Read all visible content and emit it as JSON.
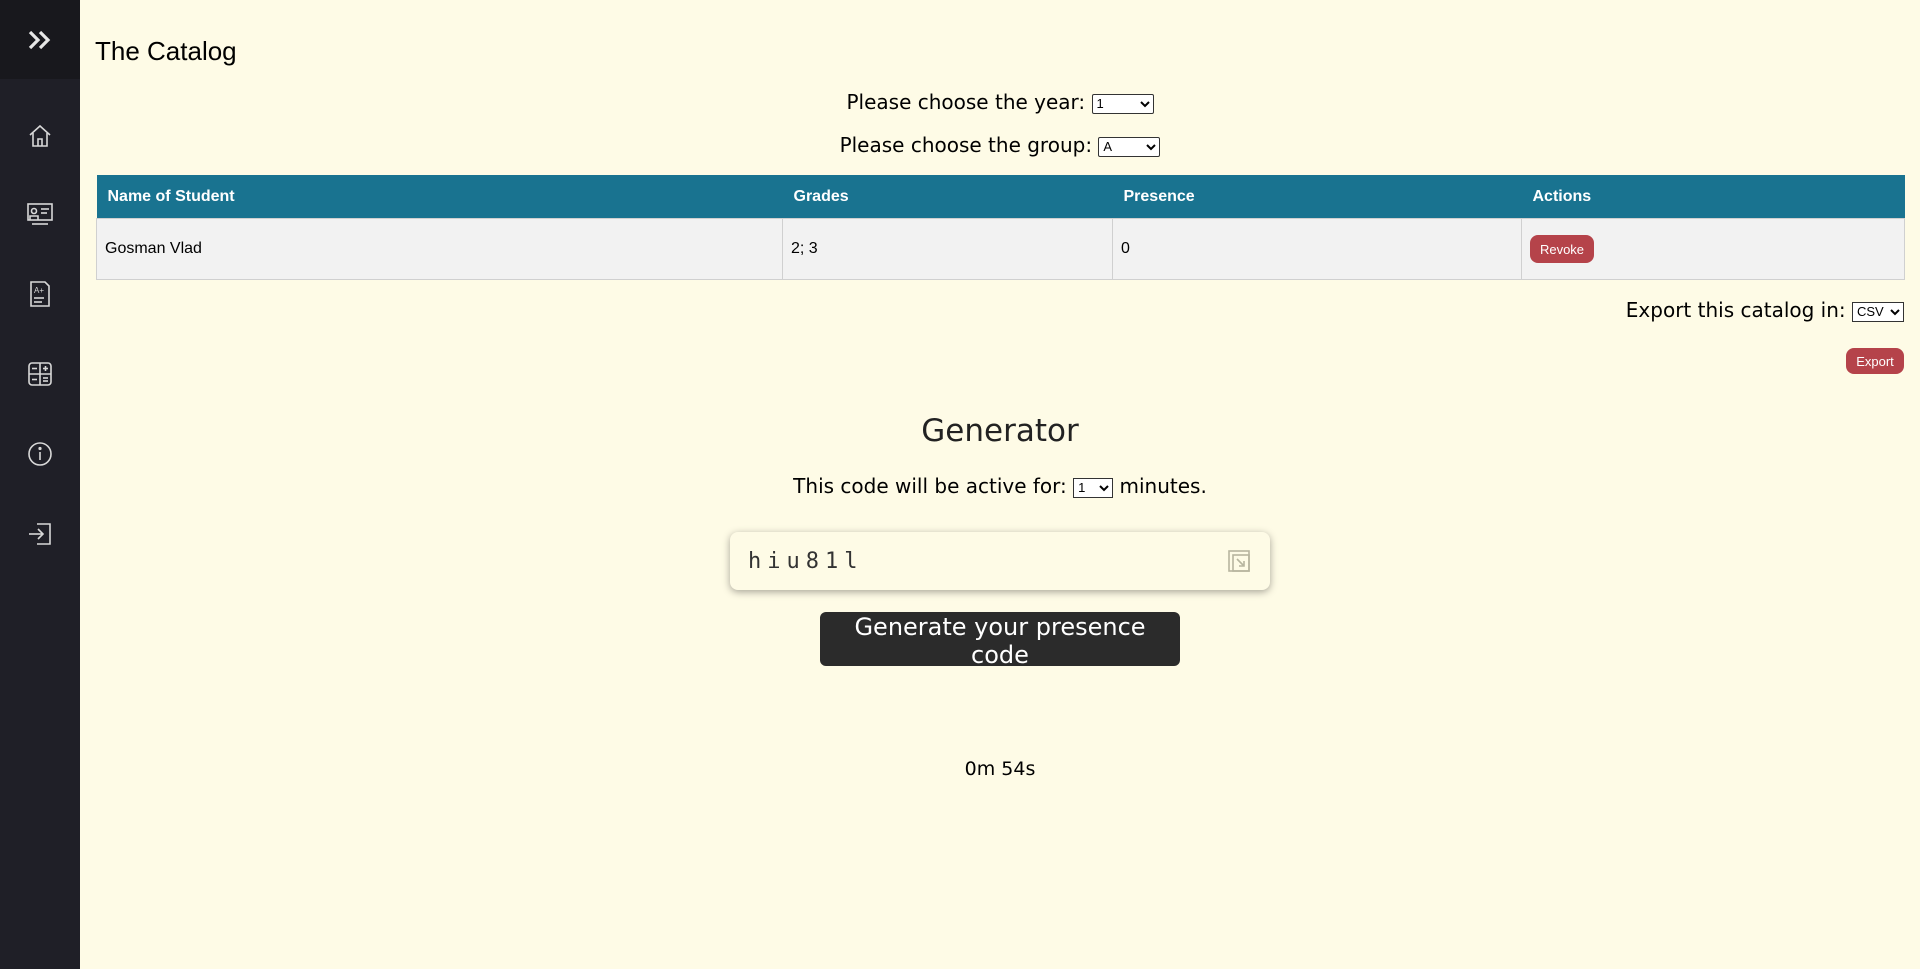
{
  "sidebar": {
    "toggle_label": "»",
    "items": [
      {
        "icon": "home-icon"
      },
      {
        "icon": "teacher-board-icon"
      },
      {
        "icon": "grades-document-icon"
      },
      {
        "icon": "calculator-icon"
      },
      {
        "icon": "info-icon"
      },
      {
        "icon": "logout-icon"
      }
    ]
  },
  "page": {
    "title": "The Catalog"
  },
  "filters": {
    "year_label": "Please choose the year:",
    "year_value": "1",
    "group_label": "Please choose the group:",
    "group_value": "A"
  },
  "table": {
    "headers": [
      "Name of Student",
      "Grades",
      "Presence",
      "Actions"
    ],
    "rows": [
      {
        "name": "Gosman Vlad",
        "grades": "2; 3",
        "presence": "0",
        "action_label": "Revoke"
      }
    ]
  },
  "export": {
    "label": "Export this catalog in:",
    "format_value": "CSV",
    "button_label": "Export"
  },
  "generator": {
    "title": "Generator",
    "active_prefix": "This code will be active for:",
    "minutes_value": "1",
    "active_suffix": "minutes.",
    "code": "hiu81l",
    "button_label": "Generate your presence code",
    "timer": "0m 54s"
  },
  "colors": {
    "background": "#fefbe6",
    "sidebar": "#1f1f27",
    "table_header": "#197390",
    "danger": "#b5434a",
    "dark_button": "#2b2b2b"
  }
}
